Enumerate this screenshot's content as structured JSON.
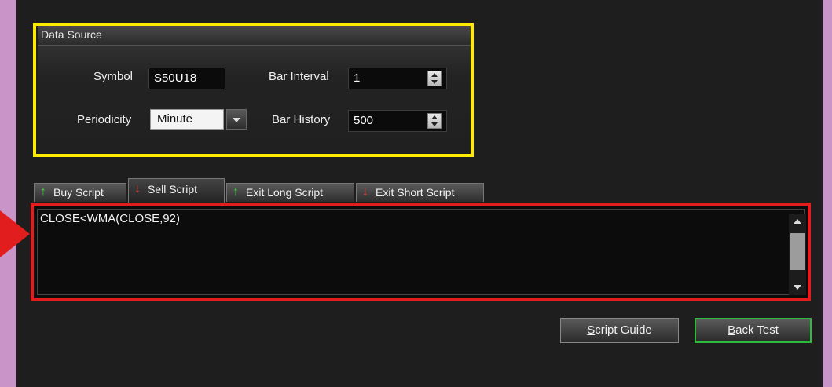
{
  "data_source": {
    "title": "Data Source",
    "symbol_label": "Symbol",
    "symbol_value": "S50U18",
    "bar_interval_label": "Bar Interval",
    "bar_interval_value": "1",
    "periodicity_label": "Periodicity",
    "periodicity_value": "Minute",
    "bar_history_label": "Bar History",
    "bar_history_value": "500"
  },
  "tabs": [
    {
      "label": "Buy Script",
      "icon": "up-arrow-icon"
    },
    {
      "label": "Sell Script",
      "icon": "down-arrow-icon"
    },
    {
      "label": "Exit Long Script",
      "icon": "up-arrow-icon"
    },
    {
      "label": "Exit Short Script",
      "icon": "down-arrow-icon"
    }
  ],
  "active_tab": "Sell Script",
  "editor": {
    "text": "CLOSE<WMA(CLOSE,92)"
  },
  "buttons": {
    "script_guide_first": "S",
    "script_guide_rest": "cript Guide",
    "back_test_first": "B",
    "back_test_rest": "ack Test"
  },
  "colors": {
    "background": "#c994c7",
    "panel": "#1e1e1e",
    "highlight_yellow": "#ffeb00",
    "highlight_red": "#e21d1d",
    "accent_green": "#2dbb3c"
  }
}
